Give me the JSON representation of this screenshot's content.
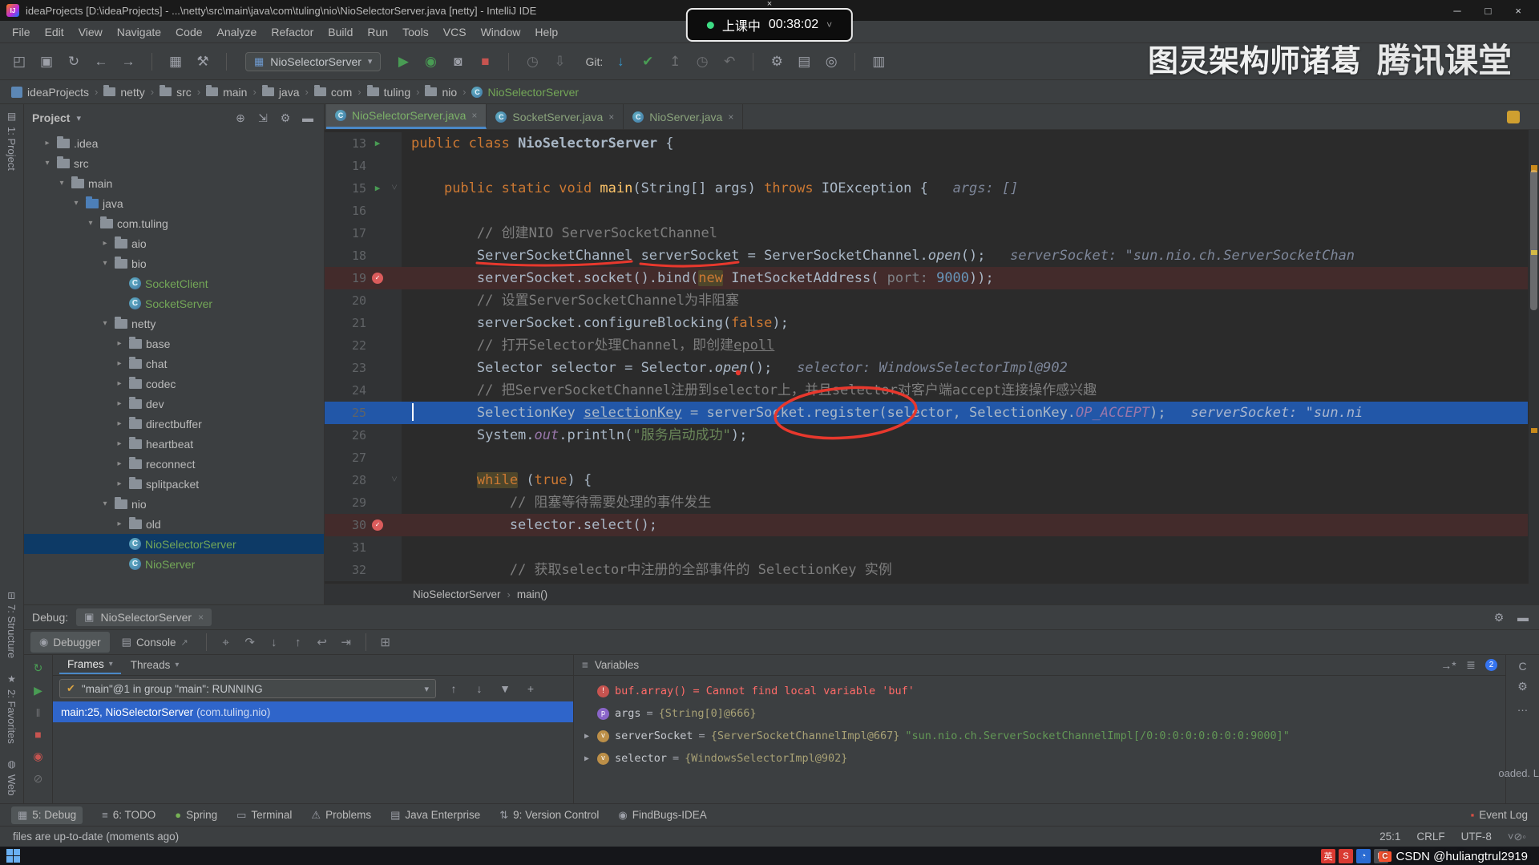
{
  "colors": {
    "accent_blue": "#3592c4",
    "debug_line": "#2257a8",
    "breakpoint_line": "#432b2b",
    "selection_blue": "#2f65ca",
    "error_red": "#ff6b68",
    "run_green": "#499c54",
    "stop_red": "#c75450",
    "file_green": "#73a657"
  },
  "icons": {
    "class_letter": "C",
    "bp_check": "✓",
    "run_arrow": "▶",
    "fold": "˅",
    "logo": "IJ",
    "varletters": {
      "error": "!",
      "param": "p",
      "local": "v"
    }
  },
  "window": {
    "title": "ideaProjects [D:\\ideaProjects] - ...\\netty\\src\\main\\java\\com\\tuling\\nio\\NioSelectorServer.java [netty] - IntelliJ IDE",
    "controls": {
      "minimize": "─",
      "maximize": "□",
      "close": "×"
    }
  },
  "overlay": {
    "close": "×",
    "status": "上课中",
    "time": "00:38:02",
    "caret": "˅"
  },
  "watermark": {
    "text": "图灵架构师诸葛",
    "logo_text": "腾讯课堂"
  },
  "csdn": {
    "logo": "C",
    "text": "CSDN @huliangtrul2919"
  },
  "menu": {
    "items": [
      "File",
      "Edit",
      "View",
      "Navigate",
      "Code",
      "Analyze",
      "Refactor",
      "Build",
      "Run",
      "Tools",
      "VCS",
      "Window",
      "Help"
    ]
  },
  "toolbar": {
    "left_icons": [
      {
        "n": "open-project-icon",
        "g": "◰"
      },
      {
        "n": "save-all-icon",
        "g": "▣"
      },
      {
        "n": "synchronize-icon",
        "g": "↻"
      },
      {
        "n": "back-icon",
        "g": "←"
      },
      {
        "n": "forward-icon",
        "g": "→"
      },
      {
        "n": "sep"
      },
      {
        "n": "layout-icon",
        "g": "▦"
      },
      {
        "n": "build-project-icon",
        "g": "⚒"
      },
      {
        "n": "sep"
      }
    ],
    "run_config": {
      "icon": "▦",
      "label": "NioSelectorServer",
      "caret": "▾"
    },
    "run_icons": [
      {
        "n": "run-icon",
        "g": "▶",
        "c": "#499c54"
      },
      {
        "n": "debug-icon",
        "g": "◉",
        "c": "#499c54"
      },
      {
        "n": "coverage-icon",
        "g": "◙",
        "c": "#9da0a8"
      },
      {
        "n": "stop-icon",
        "g": "■",
        "c": "#c75450"
      },
      {
        "n": "sep"
      },
      {
        "n": "profiler-icon",
        "g": "◷",
        "c": "#6e7073"
      },
      {
        "n": "dump-threads-icon",
        "g": "⇩",
        "c": "#6e7073"
      }
    ],
    "git_label": "Git:",
    "git_icons": [
      {
        "n": "vcs-update-icon",
        "g": "↓",
        "c": "#3592c4"
      },
      {
        "n": "vcs-commit-icon",
        "g": "✔",
        "c": "#499c54"
      },
      {
        "n": "vcs-push-icon",
        "g": "↥",
        "c": "#6e7073"
      },
      {
        "n": "vcs-history-icon",
        "g": "◷",
        "c": "#6e7073"
      },
      {
        "n": "vcs-rollback-icon",
        "g": "↶",
        "c": "#6e7073"
      },
      {
        "n": "sep"
      },
      {
        "n": "settings-gear-icon",
        "g": "⚙",
        "c": "#9da0a8"
      },
      {
        "n": "project-structure-icon",
        "g": "▤",
        "c": "#9da0a8"
      },
      {
        "n": "search-everywhere-icon",
        "g": "◎",
        "c": "#9da0a8"
      },
      {
        "n": "sep"
      },
      {
        "n": "edit-run-configs-icon",
        "g": "▥",
        "c": "#9da0a8"
      }
    ]
  },
  "breadcrumbs": {
    "sep": "›",
    "items": [
      {
        "label": "ideaProjects",
        "icon": "project"
      },
      {
        "label": "netty",
        "icon": "folder"
      },
      {
        "label": "src",
        "icon": "folder"
      },
      {
        "label": "main",
        "icon": "folder"
      },
      {
        "label": "java",
        "icon": "folder"
      },
      {
        "label": "com",
        "icon": "folder"
      },
      {
        "label": "tuling",
        "icon": "folder"
      },
      {
        "label": "nio",
        "icon": "folder"
      },
      {
        "label": "NioSelectorServer",
        "icon": "class",
        "green": true
      }
    ]
  },
  "left_strip": {
    "top": [
      {
        "label": "1: Project",
        "icon": "▤"
      }
    ],
    "bottom": [
      {
        "label": "7: Structure",
        "icon": "⊟"
      },
      {
        "label": "2: Favorites",
        "icon": "★"
      },
      {
        "label": "Web",
        "icon": "◍"
      }
    ]
  },
  "project": {
    "title": "Project",
    "caret": "▾",
    "header_icons": [
      {
        "n": "locate-file-icon",
        "g": "⊕"
      },
      {
        "n": "collapse-all-icon",
        "g": "⇲"
      },
      {
        "n": "settings-gear-icon",
        "g": "⚙"
      },
      {
        "n": "hide-panel-icon",
        "g": "▬"
      }
    ],
    "tree": [
      {
        "lvl": 4,
        "arrow": "r",
        "icon": "folder",
        "label": ".idea"
      },
      {
        "lvl": 4,
        "arrow": "d",
        "icon": "folder",
        "label": "src"
      },
      {
        "lvl": 5,
        "arrow": "d",
        "icon": "folder",
        "label": "main"
      },
      {
        "lvl": 6,
        "arrow": "d",
        "icon": "srcroot",
        "label": "java"
      },
      {
        "lvl": 7,
        "arrow": "d",
        "icon": "pkg",
        "label": "com.tuling"
      },
      {
        "lvl": 8,
        "arrow": "r",
        "icon": "pkg",
        "label": "aio"
      },
      {
        "lvl": 8,
        "arrow": "d",
        "icon": "pkg",
        "label": "bio"
      },
      {
        "lvl": 9,
        "arrow": "",
        "icon": "class",
        "label": "SocketClient",
        "green": true
      },
      {
        "lvl": 9,
        "arrow": "",
        "icon": "class",
        "label": "SocketServer",
        "green": true
      },
      {
        "lvl": 8,
        "arrow": "d",
        "icon": "pkg",
        "label": "netty"
      },
      {
        "lvl": 9,
        "arrow": "r",
        "icon": "pkg",
        "label": "base"
      },
      {
        "lvl": 9,
        "arrow": "r",
        "icon": "pkg",
        "label": "chat"
      },
      {
        "lvl": 9,
        "arrow": "r",
        "icon": "pkg",
        "label": "codec"
      },
      {
        "lvl": 9,
        "arrow": "r",
        "icon": "pkg",
        "label": "dev"
      },
      {
        "lvl": 9,
        "arrow": "r",
        "icon": "pkg",
        "label": "directbuffer"
      },
      {
        "lvl": 9,
        "arrow": "r",
        "icon": "pkg",
        "label": "heartbeat"
      },
      {
        "lvl": 9,
        "arrow": "r",
        "icon": "pkg",
        "label": "reconnect"
      },
      {
        "lvl": 9,
        "arrow": "r",
        "icon": "pkg",
        "label": "splitpacket"
      },
      {
        "lvl": 8,
        "arrow": "d",
        "icon": "pkg",
        "label": "nio"
      },
      {
        "lvl": 9,
        "arrow": "r",
        "icon": "pkg",
        "label": "old"
      },
      {
        "lvl": 9,
        "arrow": "",
        "icon": "class",
        "label": "NioSelectorServer",
        "green": true,
        "selected": true
      },
      {
        "lvl": 9,
        "arrow": "",
        "icon": "class",
        "label": "NioServer",
        "green": true
      }
    ]
  },
  "editor": {
    "tabs": [
      {
        "label": "NioSelectorServer.java",
        "close": "×",
        "active": true
      },
      {
        "label": "SocketServer.java",
        "close": "×"
      },
      {
        "label": "NioServer.java",
        "close": "×"
      }
    ],
    "crumb": {
      "sep": "›",
      "items": [
        "NioSelectorServer",
        "main()"
      ]
    },
    "code": {
      "lines": [
        {
          "n": 13,
          "g": "run",
          "s": [
            [
              "kw",
              "public class "
            ],
            [
              "cls",
              "NioSelectorServer"
            ],
            [
              "pl",
              " {"
            ]
          ]
        },
        {
          "n": 14,
          "s": []
        },
        {
          "n": 15,
          "g": "run",
          "f": true,
          "s": [
            [
              "pl",
              "    "
            ],
            [
              "kw",
              "public static void "
            ],
            [
              "mth",
              "main"
            ],
            [
              "pl",
              "(String[] args) "
            ],
            [
              "kw",
              "throws"
            ],
            [
              "pl",
              " IOException { "
            ],
            [
              "hint",
              "  args: []"
            ]
          ]
        },
        {
          "n": 16,
          "s": []
        },
        {
          "n": 17,
          "s": [
            [
              "pl",
              "        "
            ],
            [
              "cmt",
              "// 创建NIO ServerSocketChannel"
            ]
          ]
        },
        {
          "n": 18,
          "s": [
            [
              "pl",
              "        ServerSocketChannel serverSocket = ServerSocketChannel."
            ],
            [
              "itm",
              "open"
            ],
            [
              "pl",
              "();   "
            ],
            [
              "hint",
              "serverSocket: \"sun.nio.ch.ServerSocketChan"
            ]
          ]
        },
        {
          "n": 19,
          "g": "bp",
          "hl": "bp",
          "s": [
            [
              "pl",
              "        serverSocket.socket().bind("
            ],
            [
              "kwh",
              "new"
            ],
            [
              "pl",
              " InetSocketAddress( "
            ],
            [
              "ph",
              "port: "
            ],
            [
              "num",
              "9000"
            ],
            [
              "pl",
              "));"
            ]
          ]
        },
        {
          "n": 20,
          "s": [
            [
              "pl",
              "        "
            ],
            [
              "cmt",
              "// 设置ServerSocketChannel为非阻塞"
            ]
          ]
        },
        {
          "n": 21,
          "s": [
            [
              "pl",
              "        serverSocket.configureBlocking("
            ],
            [
              "kw",
              "false"
            ],
            [
              "pl",
              ");"
            ]
          ]
        },
        {
          "n": 22,
          "s": [
            [
              "pl",
              "        "
            ],
            [
              "cmt",
              "// 打开Selector处理Channel，即创建"
            ],
            [
              "cmtu",
              "epoll"
            ]
          ]
        },
        {
          "n": 23,
          "s": [
            [
              "pl",
              "        Selector selector = Selector."
            ],
            [
              "itm",
              "open"
            ],
            [
              "pl",
              "();   "
            ],
            [
              "hint",
              "selector: WindowsSelectorImpl@902"
            ]
          ]
        },
        {
          "n": 24,
          "s": [
            [
              "pl",
              "        "
            ],
            [
              "cmt",
              "// 把ServerSocketChannel注册到selector上，并且selector对客户端accept连接操作感兴趣"
            ]
          ]
        },
        {
          "n": 25,
          "hl": "dbg",
          "s": [
            [
              "pl",
              "        SelectionKey "
            ],
            [
              "undl",
              "selectionKey"
            ],
            [
              "pl",
              " = serverSocket.register(selector, SelectionKey."
            ],
            [
              "cst",
              "OP_ACCEPT"
            ],
            [
              "pl",
              ");   "
            ],
            [
              "hint",
              "serverSocket: \"sun.ni"
            ]
          ]
        },
        {
          "n": 26,
          "s": [
            [
              "pl",
              "        System."
            ],
            [
              "fld",
              "out"
            ],
            [
              "pl",
              ".println("
            ],
            [
              "str",
              "\"服务启动成功\""
            ],
            [
              "pl",
              ");"
            ]
          ]
        },
        {
          "n": 27,
          "s": []
        },
        {
          "n": 28,
          "f": true,
          "s": [
            [
              "pl",
              "        "
            ],
            [
              "kwh",
              "while"
            ],
            [
              "pl",
              " ("
            ],
            [
              "kw",
              "true"
            ],
            [
              "pl",
              ") {"
            ]
          ]
        },
        {
          "n": 29,
          "s": [
            [
              "pl",
              "            "
            ],
            [
              "cmt",
              "// 阻塞等待需要处理的事件发生"
            ]
          ]
        },
        {
          "n": 30,
          "g": "bp",
          "hl": "bp",
          "s": [
            [
              "pl",
              "            selector.select();"
            ]
          ]
        },
        {
          "n": 31,
          "s": []
        },
        {
          "n": 32,
          "s": [
            [
              "pl",
              "            "
            ],
            [
              "cmt",
              "// 获取selector中注册的全部事件的 SelectionKey 实例"
            ]
          ]
        }
      ]
    }
  },
  "debug": {
    "label": "Debug:",
    "tab": {
      "icon": "▣",
      "label": "NioSelectorServer",
      "close": "×"
    },
    "header_icons": [
      {
        "n": "settings-gear-icon",
        "g": "⚙"
      },
      {
        "n": "hide-panel-icon",
        "g": "▬"
      }
    ],
    "tool_tabs": [
      {
        "label": "Debugger",
        "icon": "◉"
      },
      {
        "label": "Console",
        "icon": "▤",
        "extra": "↗"
      }
    ],
    "step_icons": [
      {
        "n": "show-execution-point-icon",
        "g": "⌖"
      },
      {
        "n": "step-over-icon",
        "g": "↷"
      },
      {
        "n": "step-into-icon",
        "g": "↓"
      },
      {
        "n": "step-out-icon",
        "g": "↑"
      },
      {
        "n": "drop-frame-icon",
        "g": "↩"
      },
      {
        "n": "run-to-cursor-icon",
        "g": "⇥"
      },
      {
        "n": "sep"
      },
      {
        "n": "evaluate-expression-icon",
        "g": "⊞"
      }
    ],
    "right_tab_icons": [
      {
        "n": "pin-tab-icon",
        "g": "→*"
      },
      {
        "n": "layout-settings-icon",
        "g": "≣"
      },
      {
        "n": "badge",
        "g": "2"
      }
    ],
    "left_icons": [
      {
        "n": "rerun-icon",
        "g": "↻",
        "c": "#499c54"
      },
      {
        "n": "resume-icon",
        "g": "▶",
        "c": "#499c54"
      },
      {
        "n": "pause-icon",
        "g": "‖",
        "c": "#6e7073"
      },
      {
        "n": "stop-icon",
        "g": "■",
        "c": "#c75450"
      },
      {
        "n": "view-breakpoints-icon",
        "g": "◉",
        "c": "#c75450"
      },
      {
        "n": "mute-breakpoints-icon",
        "g": "⊘",
        "c": "#6e7073"
      }
    ],
    "frames": {
      "tabs": [
        {
          "label": "Frames",
          "caret": "▾"
        },
        {
          "label": "Threads",
          "caret": "▾"
        }
      ],
      "thread_check": "✔",
      "thread": "\"main\"@1 in group \"main\": RUNNING",
      "thread_caret": "▾",
      "combo_icons": [
        {
          "n": "prev-frame-icon",
          "g": "↑"
        },
        {
          "n": "next-frame-icon",
          "g": "↓"
        },
        {
          "n": "filter-icon",
          "g": "▼"
        },
        {
          "n": "add-icon",
          "g": "+"
        }
      ],
      "stack": [
        {
          "text": "main:25, NioSelectorServer ",
          "pkg": "(com.tuling.nio)",
          "selected": true
        }
      ]
    },
    "variables": {
      "title": "Variables",
      "icon": "≡",
      "rows": [
        {
          "icon": "error",
          "segs": [
            [
              "verr",
              "buf.array() = Cannot find local variable 'buf'"
            ]
          ]
        },
        {
          "icon": "param",
          "segs": [
            [
              "vname",
              "args"
            ],
            [
              "veq",
              " = "
            ],
            [
              "vval",
              "{String[0]@666}"
            ]
          ]
        },
        {
          "icon": "local",
          "arrow": "▶",
          "segs": [
            [
              "vname",
              "serverSocket"
            ],
            [
              "veq",
              " = "
            ],
            [
              "vval",
              "{ServerSocketChannelImpl@667} "
            ],
            [
              "vstr",
              "\"sun.nio.ch.ServerSocketChannelImpl[/0:0:0:0:0:0:0:0:9000]\""
            ]
          ]
        },
        {
          "icon": "local",
          "arrow": "▶",
          "segs": [
            [
              "vname",
              "selector"
            ],
            [
              "veq",
              " = "
            ],
            [
              "vval",
              "{WindowsSelectorImpl@902}"
            ]
          ]
        }
      ]
    },
    "right_strip": {
      "icons": [
        {
          "n": "soft-wrap-icon",
          "g": "C"
        },
        {
          "n": "settings-gear-icon",
          "g": "⚙"
        },
        {
          "n": "more-icon",
          "g": "…"
        }
      ],
      "fragment": "oaded. L"
    }
  },
  "bottom_bar": {
    "items": [
      {
        "label": "5: Debug",
        "g": "▦",
        "active": true
      },
      {
        "label": "6: TODO",
        "g": "≡"
      },
      {
        "label": "Spring",
        "g": "●",
        "c": "#77b255"
      },
      {
        "label": "Terminal",
        "g": "▭"
      },
      {
        "label": "Problems",
        "g": "⚠"
      },
      {
        "label": "Java Enterprise",
        "g": "▤"
      },
      {
        "label": "9: Version Control",
        "g": "⇅"
      },
      {
        "label": "FindBugs-IDEA",
        "g": "◉"
      }
    ],
    "right": {
      "label": "Event Log",
      "g": "▪",
      "c": "#d64f44"
    }
  },
  "status_bar": {
    "message": "files are up-to-date (moments ago)",
    "position": "25:1",
    "line_ending": "CRLF",
    "encoding": "UTF-8",
    "icons": [
      {
        "n": "dropdown-icon",
        "g": "˅"
      },
      {
        "n": "lock-icon",
        "g": "⊘"
      },
      {
        "n": "notifications-icon",
        "g": "◦"
      }
    ]
  },
  "taskbar": {
    "tray": [
      {
        "n": "ime-lang-icon",
        "g": "英",
        "bg": "#d93a32"
      },
      {
        "n": "tray-app-icon",
        "g": "S",
        "bg": "#d93a32"
      },
      {
        "n": "tray-clock-icon",
        "g": "◔",
        "bg": "#2a6bd2"
      },
      {
        "n": "tray-keyboard-icon",
        "g": "⊞",
        "bg": "#4a4d52"
      }
    ]
  }
}
